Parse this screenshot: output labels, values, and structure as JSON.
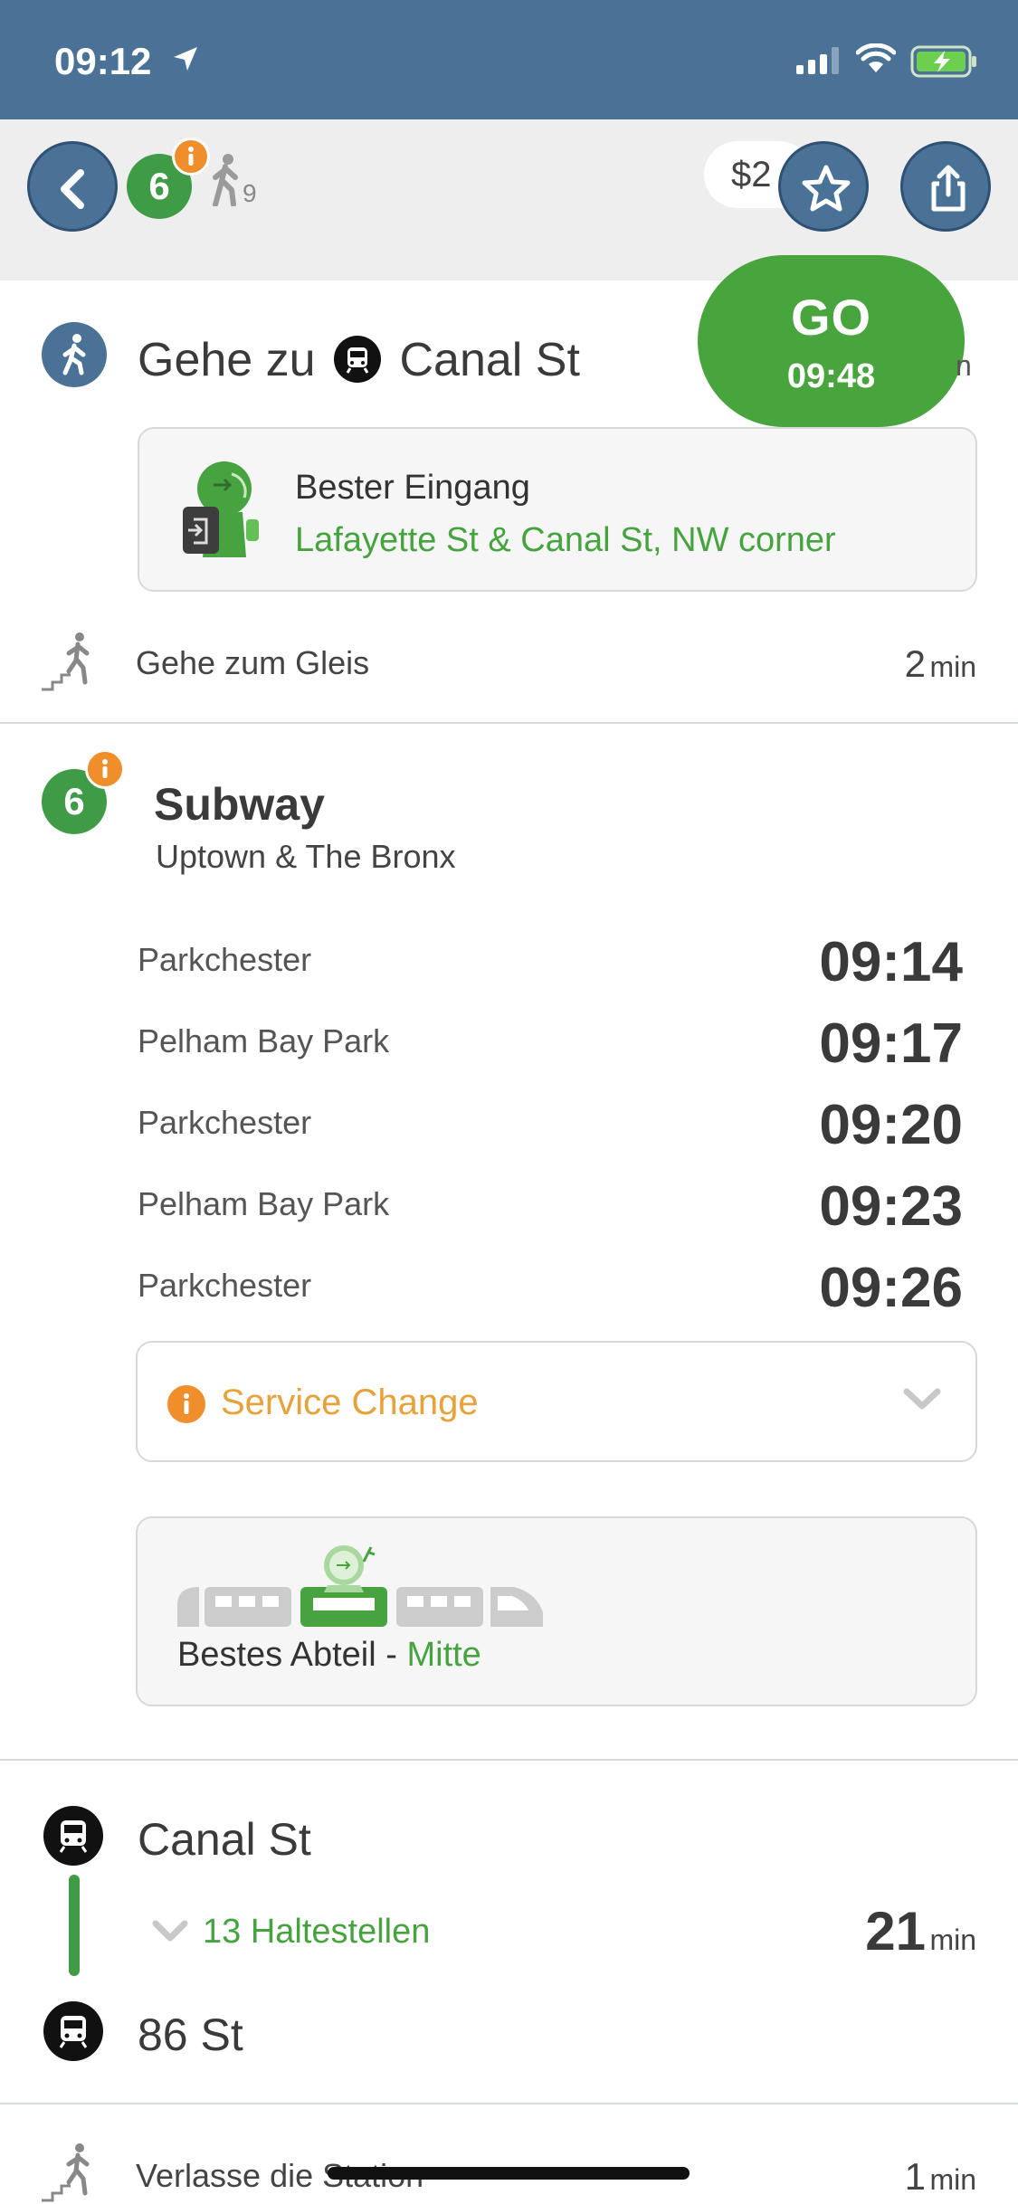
{
  "status_bar": {
    "time": "09:12",
    "icons": [
      "location-arrow-icon",
      "signal-icon",
      "wifi-icon",
      "battery-charging-icon"
    ]
  },
  "header": {
    "back_icon": "chevron-left-icon",
    "route_number": "6",
    "walk_count": "9",
    "price_peek": "$2",
    "star_icon": "star-icon",
    "share_icon": "share-icon"
  },
  "go_button": {
    "label": "GO",
    "time": "09:48"
  },
  "walk_step": {
    "prefix": "Gehe zu",
    "station": "Canal St",
    "min_peek": "n"
  },
  "entrance": {
    "label": "Bester Eingang",
    "value": "Lafayette St & Canal St, NW corner"
  },
  "platform_step": {
    "label": "Gehe zum Gleis",
    "minutes": "2",
    "unit": "min"
  },
  "subway": {
    "route": "6",
    "title": "Subway",
    "subtitle": "Uptown & The Bronx",
    "departures": [
      {
        "destination": "Parkchester",
        "time": "09:14"
      },
      {
        "destination": "Pelham Bay Park",
        "time": "09:17"
      },
      {
        "destination": "Parkchester",
        "time": "09:20"
      },
      {
        "destination": "Pelham Bay Park",
        "time": "09:23"
      },
      {
        "destination": "Parkchester",
        "time": "09:26"
      }
    ],
    "service_change": "Service Change",
    "best_car_label": "Bestes Abteil - ",
    "best_car_value": "Mitte"
  },
  "ride": {
    "from": "Canal St",
    "stops_label": "13 Haltestellen",
    "minutes": "21",
    "unit": "min",
    "to": "86 St"
  },
  "exit_step": {
    "label": "Verlasse die Station",
    "minutes": "1",
    "unit": "min"
  },
  "colors": {
    "header_blue": "#4a7196",
    "route_green": "#3f9b45",
    "go_green": "#48a43d",
    "accent_green": "#47a340",
    "alert_orange": "#ef8e2a",
    "service_amber": "#e8a23a"
  }
}
